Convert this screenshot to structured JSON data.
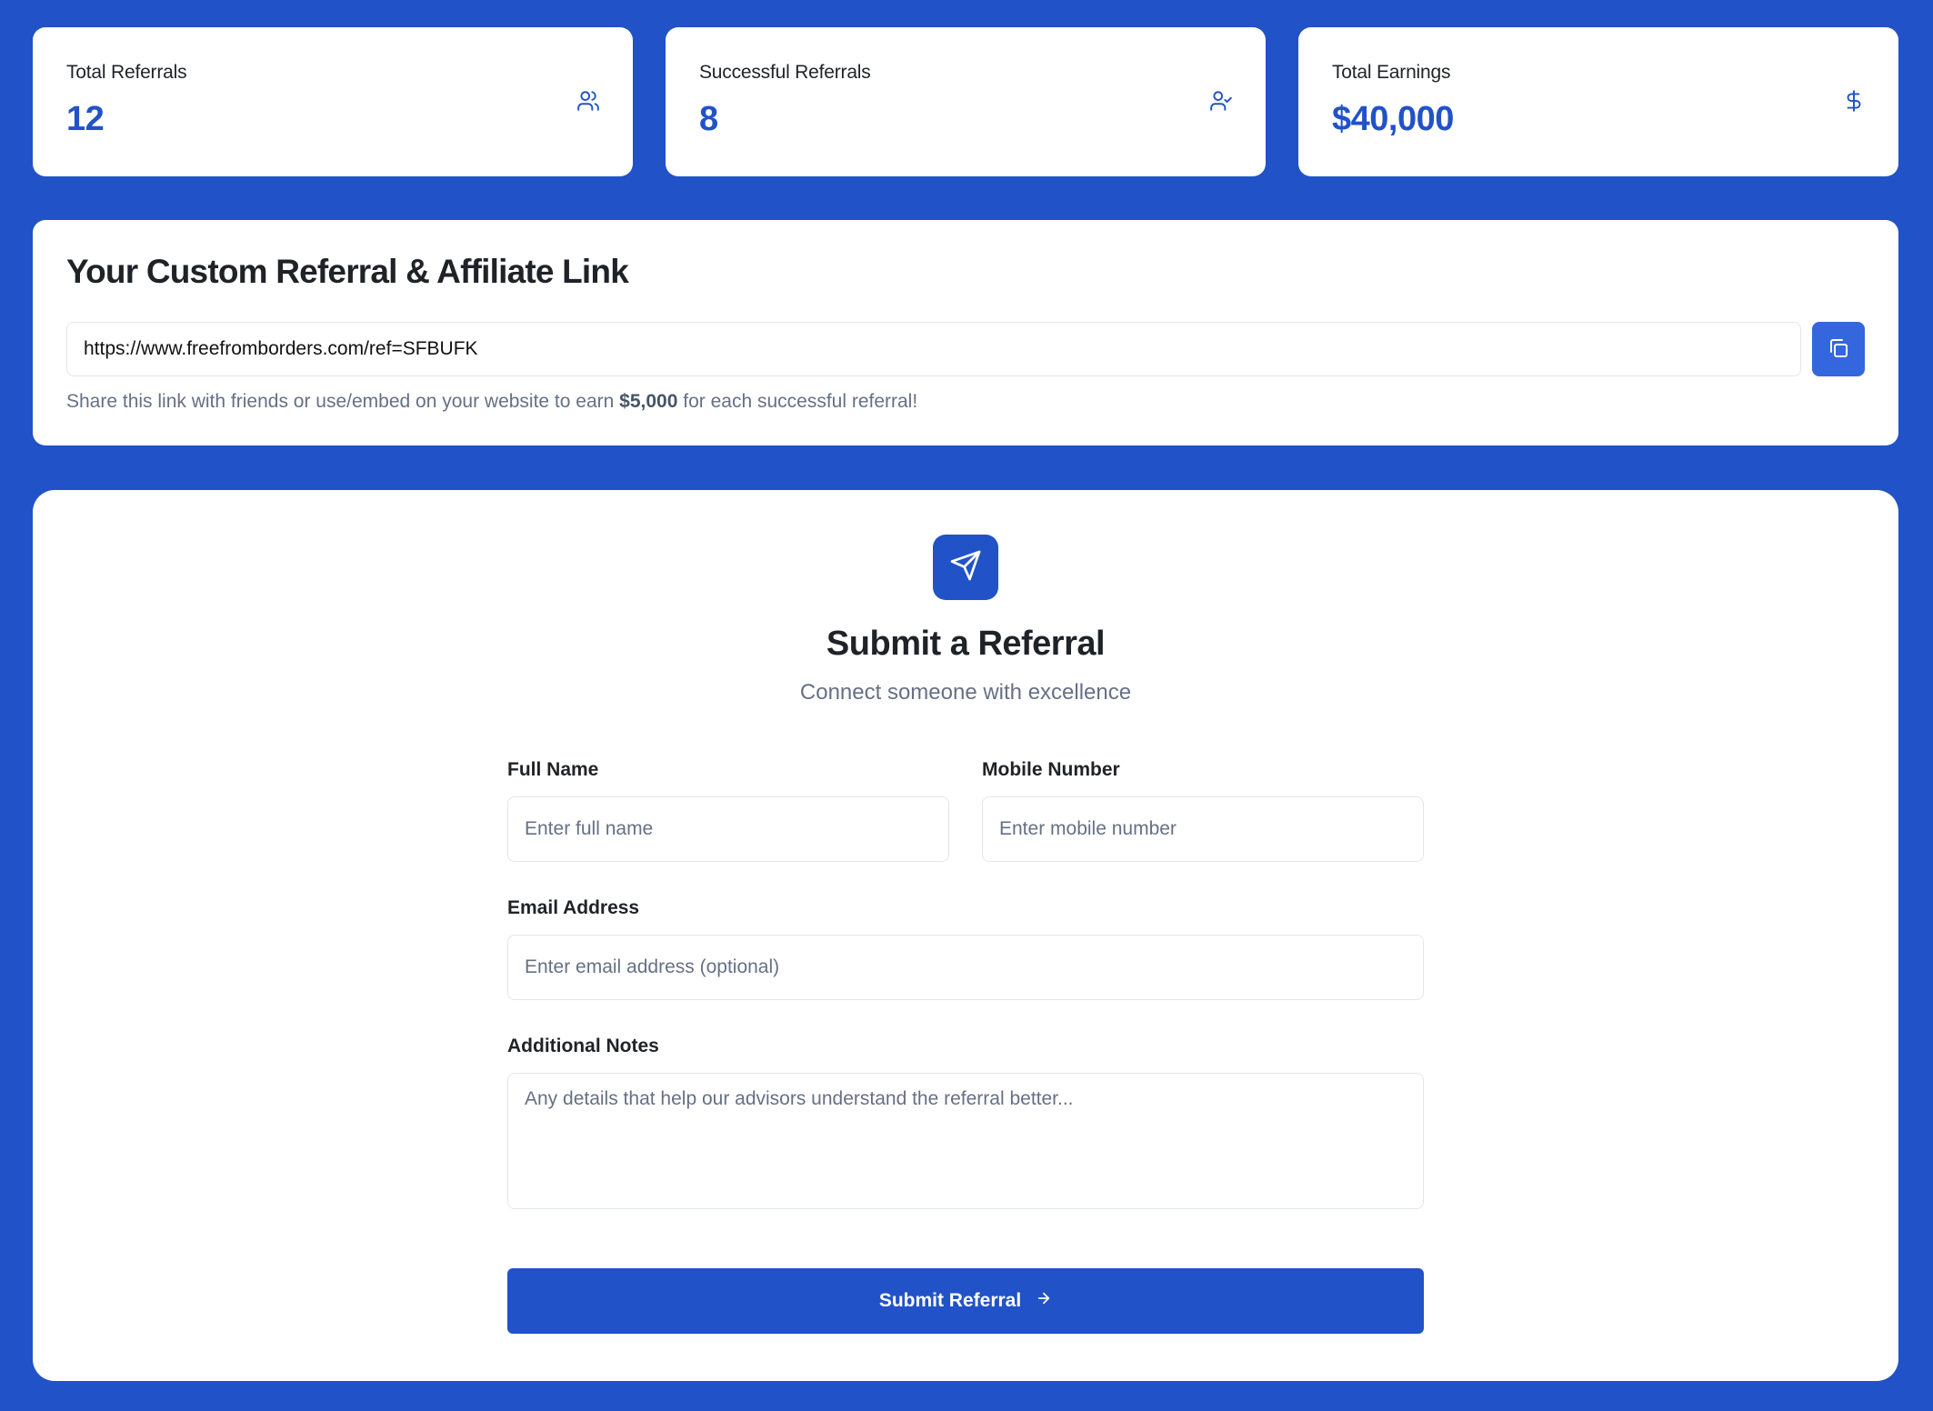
{
  "colors": {
    "brand_blue": "#2152c7",
    "copy_button_blue": "#3466de",
    "muted_text": "#667085",
    "heading_text": "#1f2328"
  },
  "stats": [
    {
      "label": "Total Referrals",
      "value": "12",
      "icon": "users-icon"
    },
    {
      "label": "Successful Referrals",
      "value": "8",
      "icon": "user-check-icon"
    },
    {
      "label": "Total Earnings",
      "value": "$40,000",
      "icon": "dollar-icon"
    }
  ],
  "link_section": {
    "title": "Your Custom Referral & Affiliate Link",
    "url": "https://www.freefromborders.com/ref=SFBUFK",
    "copy_icon": "copy-icon",
    "help_prefix": "Share this link with friends or use/embed on your website to earn",
    "help_amount": "$5,000",
    "help_suffix": "for each successful referral!"
  },
  "referral_form": {
    "icon": "send-icon",
    "title": "Submit a Referral",
    "subtitle": "Connect someone with excellence",
    "full_name": {
      "label": "Full Name",
      "placeholder": "Enter full name",
      "value": ""
    },
    "mobile": {
      "label": "Mobile Number",
      "placeholder": "Enter mobile number",
      "value": ""
    },
    "email": {
      "label": "Email Address",
      "placeholder": "Enter email address (optional)",
      "value": ""
    },
    "notes": {
      "label": "Additional Notes",
      "placeholder": "Any details that help our advisors understand the referral better...",
      "value": ""
    },
    "submit_label": "Submit Referral",
    "submit_icon": "arrow-right-icon"
  }
}
